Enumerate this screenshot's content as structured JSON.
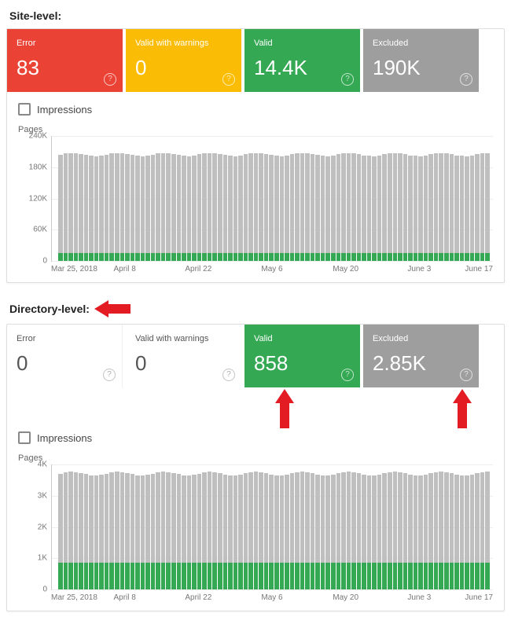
{
  "sections": {
    "site": {
      "label": "Site-level:"
    },
    "dir": {
      "label": "Directory-level:"
    }
  },
  "impressions_label": "Impressions",
  "axis_title": "Pages",
  "colors": {
    "error": "#ea4335",
    "warn": "#fbbc05",
    "valid": "#34a853",
    "excluded": "#9e9e9e"
  },
  "cards": {
    "site": {
      "error": {
        "label": "Error",
        "value": "83"
      },
      "warn": {
        "label": "Valid with warnings",
        "value": "0"
      },
      "valid": {
        "label": "Valid",
        "value": "14.4K"
      },
      "excluded": {
        "label": "Excluded",
        "value": "190K"
      }
    },
    "dir": {
      "error": {
        "label": "Error",
        "value": "0"
      },
      "warn": {
        "label": "Valid with warnings",
        "value": "0"
      },
      "valid": {
        "label": "Valid",
        "value": "858"
      },
      "excluded": {
        "label": "Excluded",
        "value": "2.85K"
      }
    }
  },
  "chart_data": [
    {
      "id": "site",
      "type": "bar",
      "title": "Pages",
      "xlabel": "",
      "ylabel": "Pages",
      "ylim": [
        0,
        240000
      ],
      "yticks": [
        0,
        60000,
        120000,
        180000,
        240000
      ],
      "ytick_labels": [
        "0",
        "60K",
        "120K",
        "180K",
        "240K"
      ],
      "x_tick_labels": [
        "Mar 25, 2018",
        "April 8",
        "April 22",
        "May 6",
        "May 20",
        "June 3",
        "June 17"
      ],
      "series": [
        {
          "name": "Excluded",
          "value_approx": 190000
        },
        {
          "name": "Valid",
          "value_approx": 14400
        }
      ],
      "n_bars": 84,
      "note": "Values roughly constant across the date range; each bar stacks Valid (green) at bottom + Excluded (gray) above."
    },
    {
      "id": "dir",
      "type": "bar",
      "title": "Pages",
      "xlabel": "",
      "ylabel": "Pages",
      "ylim": [
        0,
        4000
      ],
      "yticks": [
        0,
        1000,
        2000,
        3000,
        4000
      ],
      "ytick_labels": [
        "0",
        "1K",
        "2K",
        "3K",
        "4K"
      ],
      "x_tick_labels": [
        "Mar 25, 2018",
        "April 8",
        "April 22",
        "May 6",
        "May 20",
        "June 3",
        "June 17"
      ],
      "series": [
        {
          "name": "Excluded",
          "value_approx": 2850
        },
        {
          "name": "Valid",
          "value_approx": 858
        }
      ],
      "n_bars": 84,
      "note": "Values roughly constant across the date range; each bar stacks Valid (green) at bottom + Excluded (gray) above."
    }
  ]
}
